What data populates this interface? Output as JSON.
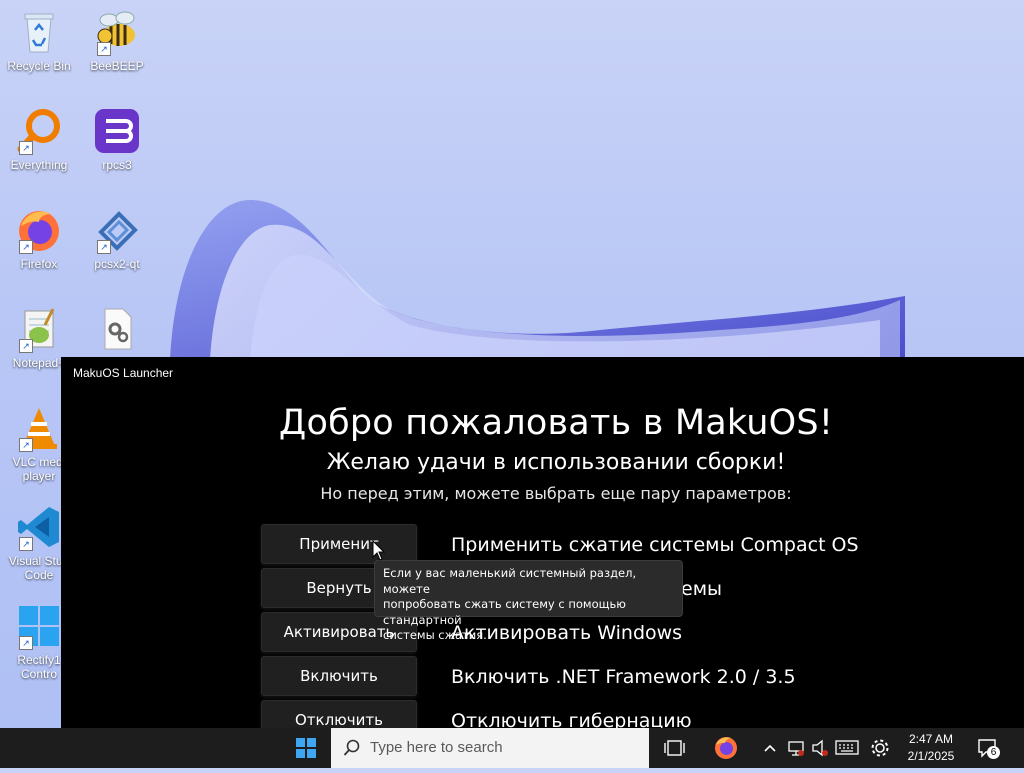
{
  "desktop": {
    "icons": [
      {
        "label": "Recycle Bin",
        "icon": "recycle-bin-icon"
      },
      {
        "label": "BeeBEEP",
        "icon": "bee-icon"
      },
      {
        "label": "Everything",
        "icon": "magnifier-icon"
      },
      {
        "label": "rpcs3",
        "icon": "rpcs3-icon"
      },
      {
        "label": "Firefox",
        "icon": "firefox-icon"
      },
      {
        "label": "pcsx2-qt",
        "icon": "pcsx2-icon"
      },
      {
        "label": "Notepad+",
        "icon": "notepad-plus-icon"
      },
      {
        "label": "",
        "icon": "settings-file-icon"
      },
      {
        "label": "VLC medi player",
        "icon": "vlc-icon"
      },
      {
        "label": "Visual Stud Code",
        "icon": "vscode-icon"
      },
      {
        "label": "Rectify1 Contro",
        "icon": "windows-logo-icon"
      }
    ]
  },
  "launcher": {
    "window_title": "MakuOS Launcher",
    "heading": "Добро пожаловать в MakuOS!",
    "subtitle": "Желаю удачи в использовании сборки!",
    "prompt": "Но перед этим, можете выбрать еще пару параметров:",
    "options": [
      {
        "button": "Применит",
        "description": "Применить сжатие системы Compact OS"
      },
      {
        "button": "Вернуть",
        "description": "емы"
      },
      {
        "button": "Активировать",
        "description": "Активировать Windows"
      },
      {
        "button": "Включить",
        "description": "Включить .NET Framework 2.0 / 3.5"
      },
      {
        "button": "Отключить",
        "description": "Отключить гибернацию"
      }
    ],
    "tooltip": {
      "line1": "Если у вас маленький системный раздел, можете",
      "line2": "попробовать сжать систему с помощью стандартной",
      "line3": "системы сжатия."
    }
  },
  "taskbar": {
    "search_placeholder": "Type here to search",
    "time": "2:47 AM",
    "date": "2/1/2025",
    "notification_count": "6"
  }
}
